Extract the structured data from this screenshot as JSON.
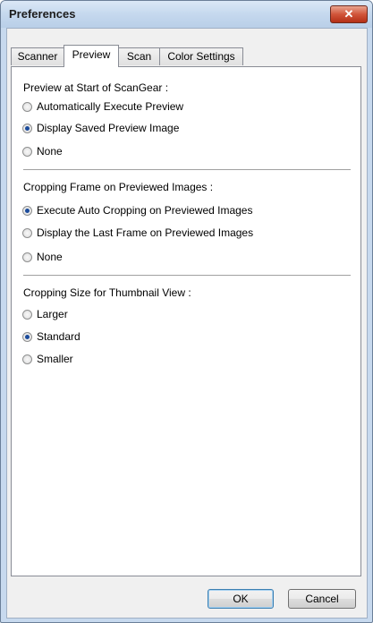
{
  "window": {
    "title": "Preferences",
    "close_label": "✕"
  },
  "tabs": [
    {
      "label": "Scanner",
      "active": false
    },
    {
      "label": "Preview",
      "active": true
    },
    {
      "label": "Scan",
      "active": false
    },
    {
      "label": "Color Settings",
      "active": false
    }
  ],
  "groups": [
    {
      "label": "Preview at Start of ScanGear :",
      "options": [
        {
          "label": "Automatically Execute Preview",
          "selected": false
        },
        {
          "label": "Display Saved Preview Image",
          "selected": true
        },
        {
          "label": "None",
          "selected": false
        }
      ]
    },
    {
      "label": "Cropping Frame on Previewed Images :",
      "options": [
        {
          "label": "Execute Auto Cropping on Previewed Images",
          "selected": true
        },
        {
          "label": "Display the Last Frame on Previewed Images",
          "selected": false
        },
        {
          "label": "None",
          "selected": false
        }
      ]
    },
    {
      "label": "Cropping Size for Thumbnail View :",
      "options": [
        {
          "label": "Larger",
          "selected": false
        },
        {
          "label": "Standard",
          "selected": true
        },
        {
          "label": "Smaller",
          "selected": false
        }
      ]
    }
  ],
  "buttons": {
    "ok": "OK",
    "cancel": "Cancel"
  }
}
